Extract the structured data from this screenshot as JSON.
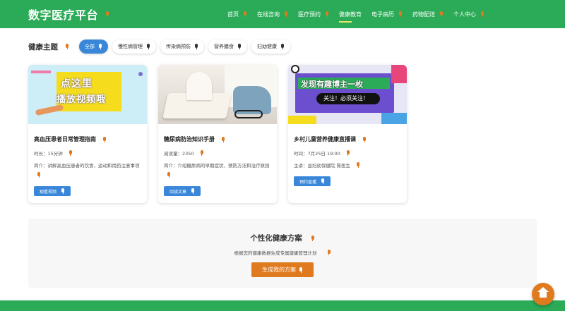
{
  "app": {
    "title": "数字医疗平台"
  },
  "nav": {
    "items": [
      {
        "label": "首页"
      },
      {
        "label": "在线咨询"
      },
      {
        "label": "医疗预约"
      },
      {
        "label": "健康教育"
      },
      {
        "label": "电子病历"
      },
      {
        "label": "药物配送"
      },
      {
        "label": "个人中心"
      }
    ],
    "active": "健康教育"
  },
  "topics": {
    "title": "健康主题",
    "filters": [
      {
        "label": "全部"
      },
      {
        "label": "慢性病管理"
      },
      {
        "label": "传染病预防"
      },
      {
        "label": "营养膳食"
      },
      {
        "label": "妇幼健康"
      }
    ],
    "active": "全部"
  },
  "cards": [
    {
      "thumb_text_1": "点这里",
      "thumb_text_2": "播放视频哦",
      "title": "高血压患者日常管理指南",
      "meta": "时长：15分钟",
      "desc": "简介：讲解高血压患者的饮食、运动和用药注意事项",
      "button": "观看视频"
    },
    {
      "title": "糖尿病防治知识手册",
      "meta": "阅读量：2350",
      "desc": "简介：介绍糖尿病的早期症状、预防方法和治疗原则",
      "button": "阅读文章"
    },
    {
      "thumb_text_1": "发现有趣博主一枚",
      "thumb_text_2": "关注！必须关注！",
      "title": "乡村儿童营养健康直播课",
      "meta": "时间：7月25日 19:00",
      "meta2": "主讲：县妇幼保健院 陈医生",
      "button": "预约直播"
    }
  ],
  "plan": {
    "title": "个性化健康方案",
    "subtitle": "根据您的健康数据生成专属健康管理计划",
    "button": "生成我的方案"
  },
  "colors": {
    "primary": "#2bab57",
    "accent": "#e07a1f",
    "blue": "#3a87d9"
  },
  "icons": {
    "mic": "microphone-icon",
    "fab": "home-icon"
  }
}
